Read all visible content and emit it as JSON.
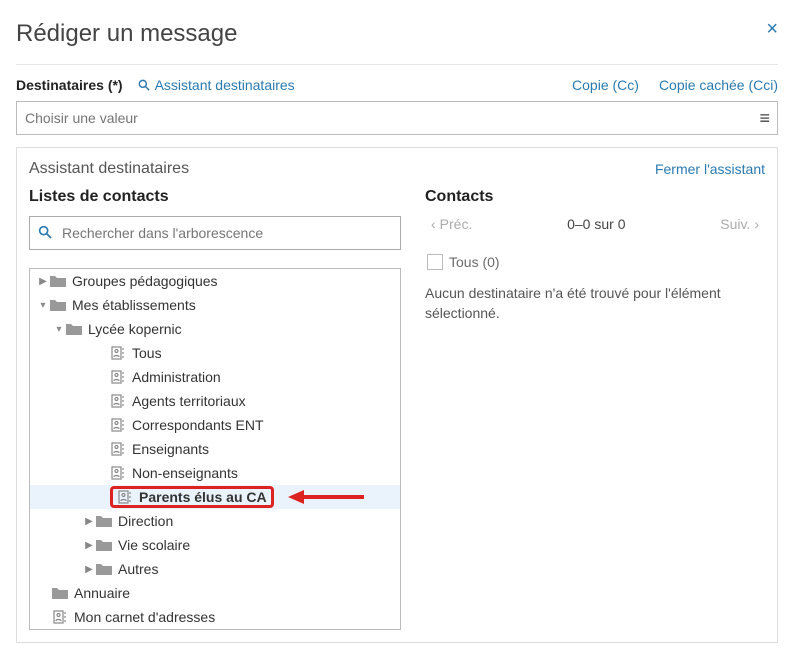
{
  "header": {
    "title": "Rédiger un message"
  },
  "recipients": {
    "label": "Destinataires (*)",
    "assistant_link": "Assistant destinataires",
    "cc": "Copie (Cc)",
    "bcc": "Copie cachée (Cci)",
    "input_placeholder": "Choisir une valeur"
  },
  "assistant": {
    "title": "Assistant destinataires",
    "close": "Fermer l'assistant"
  },
  "left": {
    "title": "Listes de contacts",
    "search_placeholder": "Rechercher dans l'arborescence",
    "tree": {
      "groupes": "Groupes pédagogiques",
      "etabs": "Mes établissements",
      "lycee": "Lycée kopernic",
      "tous": "Tous",
      "admin": "Administration",
      "agents": "Agents territoriaux",
      "corresp": "Correspondants ENT",
      "ens": "Enseignants",
      "nonens": "Non-enseignants",
      "parents": "Parents élus au CA",
      "direction": "Direction",
      "viescolaire": "Vie scolaire",
      "autres": "Autres",
      "annuaire": "Annuaire",
      "carnet": "Mon carnet d'adresses"
    }
  },
  "right": {
    "title": "Contacts",
    "prev": "Préc.",
    "range": "0–0 sur 0",
    "next": "Suiv.",
    "tous": "Tous (0)",
    "empty": "Aucun destinataire n'a été trouvé pour l'élément sélectionné."
  }
}
